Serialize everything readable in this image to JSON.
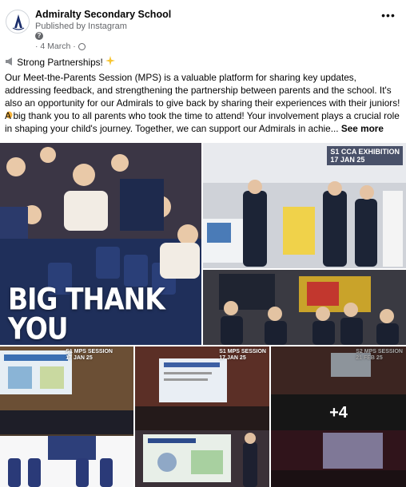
{
  "post": {
    "page_name": "Admiralty Secondary School",
    "published_via": "Published by Instagram",
    "date": "· 4 March ·",
    "text": {
      "line1_icon": "megaphone-icon",
      "line1": "Strong Partnerships!",
      "line1_emoji": "sparkle-icon",
      "para2": "Our Meet-the-Parents Session (MPS) is a valuable platform for sharing key updates, addressing feedback, and strengthening the partnership between parents and the school. It's also an opportunity for our Admirals to give back by sharing their experiences with their juniors!",
      "para2_emoji": "clap-icon",
      "para3": "A big thank you to all parents who took the time to attend! Your involvement plays a crucial role in shaping your child's journey. Together, we can support our Admirals in achie...",
      "see_more": "See more"
    }
  },
  "photos": {
    "main_caption": "BIG THANK YOU PARENTS",
    "cca_caption_line1": "S1 CCA EXHIBITION",
    "cca_caption_line2": "17 JAN 25",
    "tile3_caption_line1": "S1 MPS SESSION",
    "tile3_caption_line2": "17 JAN 25",
    "tile4_caption_line1": "S1 MPS SESSION",
    "tile4_caption_line2": "17 JAN 25",
    "tile5_caption_line1": "S2 MPS SESSION",
    "tile5_caption_line2": "21 FEB 25",
    "more_count": "+4"
  },
  "colors": {
    "secondary_text": "#65676b",
    "text": "#050505"
  }
}
